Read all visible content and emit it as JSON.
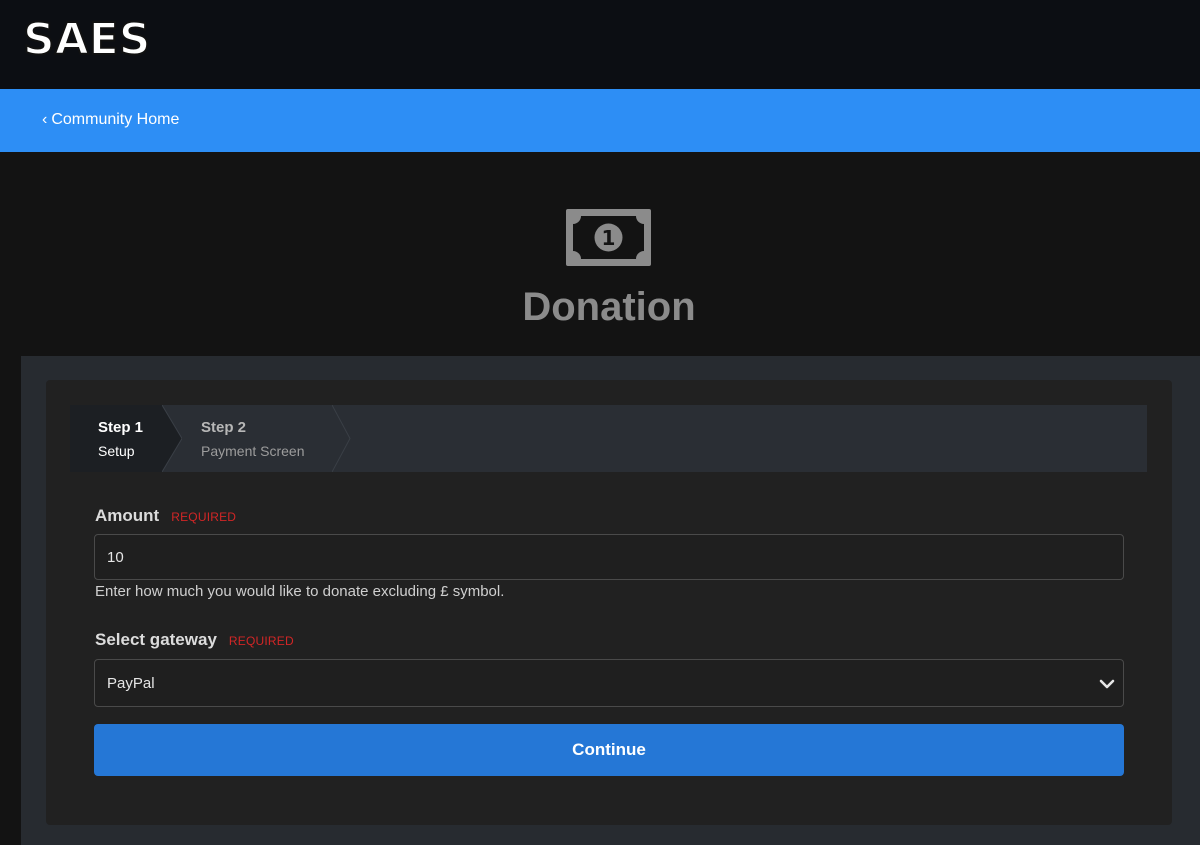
{
  "header": {
    "logo_text": "SAES",
    "logo_icon": "saes-logo"
  },
  "nav": {
    "back_label": "Community Home",
    "back_icon": "chevron-left-icon"
  },
  "hero": {
    "icon": "money-bill-icon",
    "title": "Donation"
  },
  "steps": [
    {
      "title": "Step 1",
      "subtitle": "Setup",
      "active": true
    },
    {
      "title": "Step 2",
      "subtitle": "Payment Screen",
      "active": false
    }
  ],
  "form": {
    "amount": {
      "label": "Amount",
      "required_label": "REQUIRED",
      "value": "10",
      "help": "Enter how much you would like to donate excluding £ symbol."
    },
    "gateway": {
      "label": "Select gateway",
      "required_label": "REQUIRED",
      "selected": "PayPal"
    },
    "continue_label": "Continue"
  },
  "colors": {
    "accent": "#2d8ef5",
    "button": "#2577d6",
    "required": "#d22626",
    "background": "#131313"
  }
}
